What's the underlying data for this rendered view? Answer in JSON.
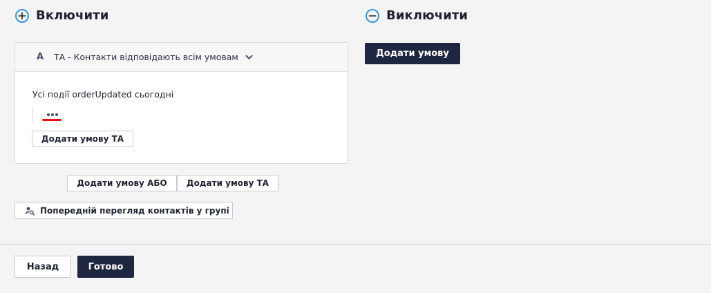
{
  "include": {
    "title": "Включити",
    "icon": "plus-circle-icon"
  },
  "exclude": {
    "title": "Виключити",
    "icon": "minus-circle-icon",
    "add_condition_label": "Додати умову"
  },
  "card": {
    "letter": "A",
    "header_label": "ТА - Контакти відповідають всім умовам",
    "event_text": "Усі події orderUpdated сьогодні",
    "add_and_label": "Додати умову ТА"
  },
  "group_actions": {
    "add_or_label": "Додати умову АБО",
    "add_and_label": "Додати умову ТА",
    "preview_label": "Попередній перегляд контактів у групі"
  },
  "footer": {
    "back_label": "Назад",
    "done_label": "Готово"
  },
  "colors": {
    "accent_blue": "#3b95d6",
    "primary_dark": "#1f2640",
    "highlight_red": "#e5141b"
  }
}
